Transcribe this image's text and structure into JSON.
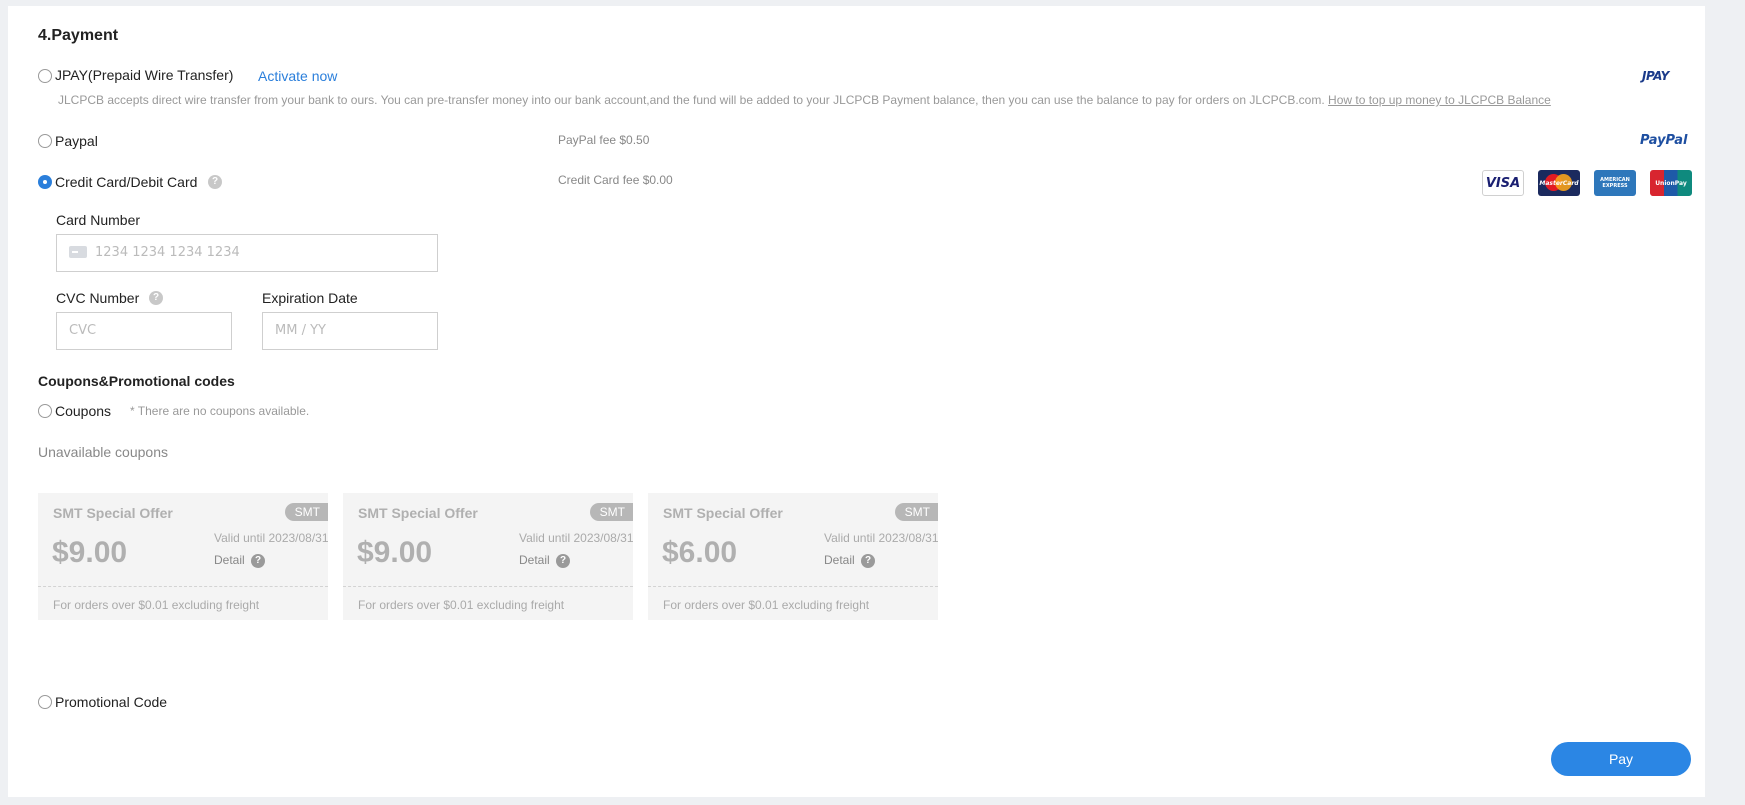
{
  "payment": {
    "section_title": "4.Payment",
    "jpay": {
      "label": "JPAY(Prepaid Wire Transfer)",
      "activate_link": "Activate now",
      "description": "JLCPCB accepts direct wire transfer from your bank to ours. You can pre-transfer money into our bank account,and the fund will be added to your JLCPCB Payment balance, then you can use the balance to pay for orders on JLCPCB.com.",
      "help_link": "How to top up money to JLCPCB Balance",
      "logo_text": "JPAY",
      "selected": false
    },
    "paypal": {
      "label": "Paypal",
      "fee": "PayPal fee $0.50",
      "logo_text": "PayPal",
      "selected": false
    },
    "credit_card": {
      "label": "Credit Card/Debit Card",
      "fee": "Credit Card fee $0.00",
      "selected": true,
      "logos": [
        "VISA",
        "MasterCard",
        "AMERICAN EXPRESS",
        "UnionPay"
      ],
      "card_number_label": "Card Number",
      "card_number_placeholder": "1234 1234 1234 1234",
      "cvc_label": "CVC Number",
      "cvc_placeholder": "CVC",
      "expiry_label": "Expiration Date",
      "expiry_placeholder": "MM / YY"
    }
  },
  "coupons_section": {
    "title": "Coupons&Promotional codes",
    "coupons_label": "Coupons",
    "coupons_note": "* There are no coupons available.",
    "unavailable_title": "Unavailable coupons",
    "cards": [
      {
        "title": "SMT Special Offer",
        "tag": "SMT",
        "amount": "$9.00",
        "valid": "Valid until 2023/08/31",
        "detail": "Detail",
        "condition": "For orders over $0.01 excluding freight"
      },
      {
        "title": "SMT Special Offer",
        "tag": "SMT",
        "amount": "$9.00",
        "valid": "Valid until 2023/08/31",
        "detail": "Detail",
        "condition": "For orders over $0.01 excluding freight"
      },
      {
        "title": "SMT Special Offer",
        "tag": "SMT",
        "amount": "$6.00",
        "valid": "Valid until 2023/08/31",
        "detail": "Detail",
        "condition": "For orders over $0.01 excluding freight"
      }
    ],
    "promo_label": "Promotional Code"
  },
  "actions": {
    "pay_label": "Pay"
  },
  "colors": {
    "accent": "#2b86e4",
    "link": "#2b7fdb"
  }
}
